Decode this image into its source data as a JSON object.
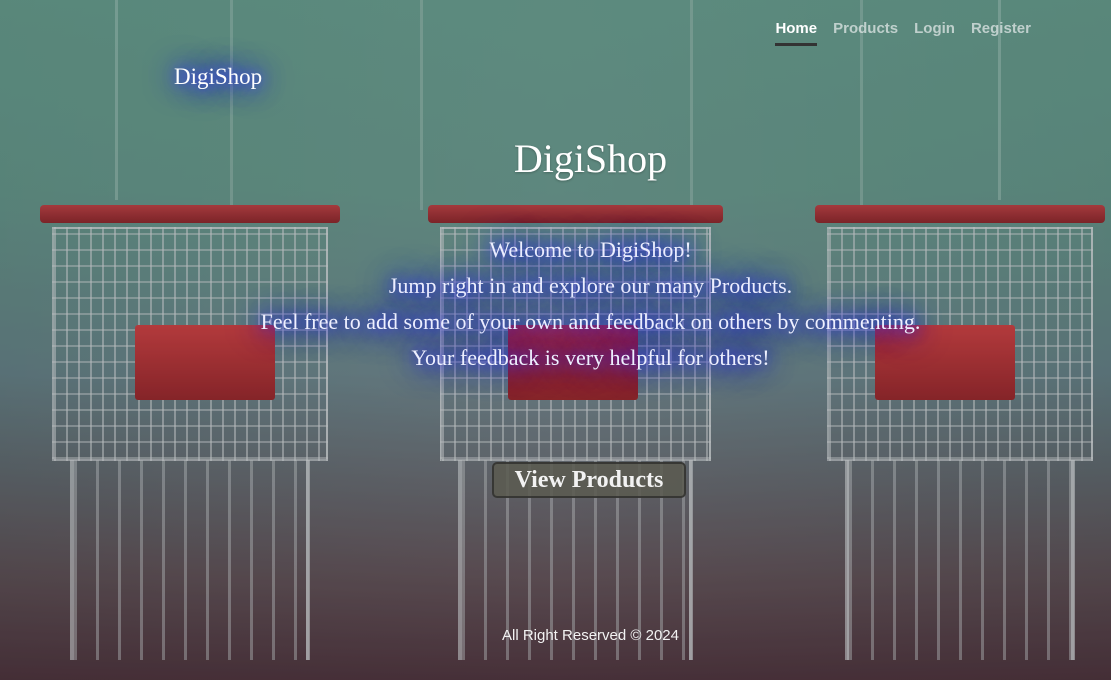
{
  "brand": "DigiShop",
  "nav": {
    "items": [
      {
        "label": "Home",
        "active": true
      },
      {
        "label": "Products",
        "active": false
      },
      {
        "label": "Login",
        "active": false
      },
      {
        "label": "Register",
        "active": false
      }
    ]
  },
  "hero": {
    "title": "DigiShop",
    "lines": [
      "Welcome to DigiShop!",
      "Jump right in and explore our many Products.",
      "Feel free to add some of your own and feedback on others by commenting.",
      "Your feedback is very helpful for others!"
    ],
    "button_label": "View Products"
  },
  "footer": {
    "text": "All Right Reserved © 2024"
  },
  "colors": {
    "accent_glow": "#2c2cff",
    "nav_active_underline": "#333333",
    "cart_red": "#c0393b"
  }
}
